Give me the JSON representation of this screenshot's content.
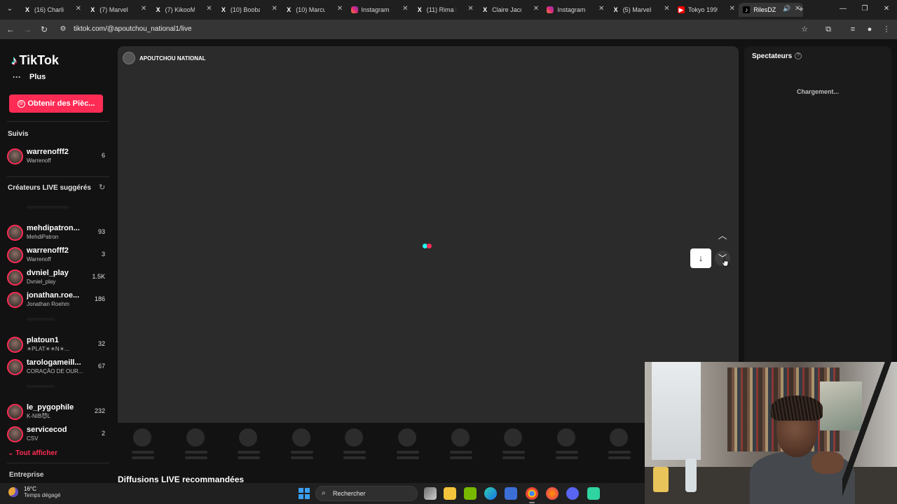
{
  "browser": {
    "tabs": [
      {
        "label": "(16) Charlie",
        "favicon": "x-icon"
      },
      {
        "label": "(7) Marvel Fi",
        "favicon": "x-icon"
      },
      {
        "label": "(7) KikooMa",
        "favicon": "x-icon"
      },
      {
        "label": "(10) Booba |",
        "favicon": "x-icon"
      },
      {
        "label": "(10) Marcus",
        "favicon": "x-icon"
      },
      {
        "label": "Instagram",
        "favicon": "instagram-icon"
      },
      {
        "label": "(11) Rima Ha",
        "favicon": "x-icon"
      },
      {
        "label": "Claire Jacqu",
        "favicon": "x-icon"
      },
      {
        "label": "Instagram",
        "favicon": "instagram-icon"
      },
      {
        "label": "(5) Marvel Fi",
        "favicon": "x-icon"
      },
      {
        "label": "Tokyo 1995",
        "favicon": "youtube-icon"
      },
      {
        "label": "RilesDZ",
        "favicon": "tiktok-icon",
        "active": true
      }
    ],
    "url": "tiktok.com/@apoutchou_national1/live"
  },
  "sidebar": {
    "logo_text": "TikTok",
    "more_label": "Plus",
    "coins_button": "Obtenir des Pièc...",
    "followed_title": "Suivis",
    "followed": [
      {
        "name": "warrenofff2",
        "sub": "Warrenoff",
        "count": "6"
      }
    ],
    "suggested_title": "Créateurs LIVE suggérés",
    "suggested": [
      {
        "name": "mehdipatron...",
        "sub": "MehdiPatron",
        "count": "93"
      },
      {
        "name": "warrenofff2",
        "sub": "Warrenoff",
        "count": "3"
      },
      {
        "name": "dvniel_play",
        "sub": "Dvniel_play",
        "count": "1.5K"
      },
      {
        "name": "jonathan.roe...",
        "sub": "Jonathan Roehm",
        "count": "186"
      },
      {
        "name": "platoun1",
        "sub": "☀PLAT☀☀N☀...",
        "count": "32"
      },
      {
        "name": "tarologameill...",
        "sub": "CORAÇÃO DE OUR...",
        "count": "67"
      },
      {
        "name": "le_pygophile",
        "sub": "K-NIB😈L",
        "count": "232"
      },
      {
        "name": "servicecod",
        "sub": "CSV",
        "count": "2"
      }
    ],
    "see_all": "Tout afficher",
    "company": "Entreprise"
  },
  "live": {
    "streamer_name": "APOUTCHOU NATIONAL",
    "recommended_title": "Diffusions LIVE recommandées"
  },
  "viewers": {
    "title": "Spectateurs",
    "loading": "Chargement..."
  },
  "taskbar": {
    "temperature": "16°C",
    "weather": "Temps dégagé",
    "search_placeholder": "Rechercher"
  },
  "colors": {
    "tiktok_red": "#fe2c55",
    "tiktok_cyan": "#25f4ee",
    "windows_blue": "#3a9ff2"
  }
}
